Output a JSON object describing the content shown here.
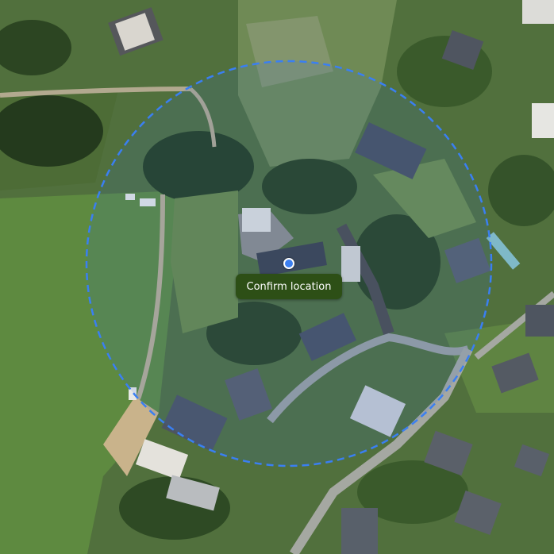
{
  "map": {
    "view": "satellite",
    "radius_circle_color": "#3a7ff2",
    "pin_color": "#3d7ff0"
  },
  "actions": {
    "confirm_label": "Confirm location"
  }
}
